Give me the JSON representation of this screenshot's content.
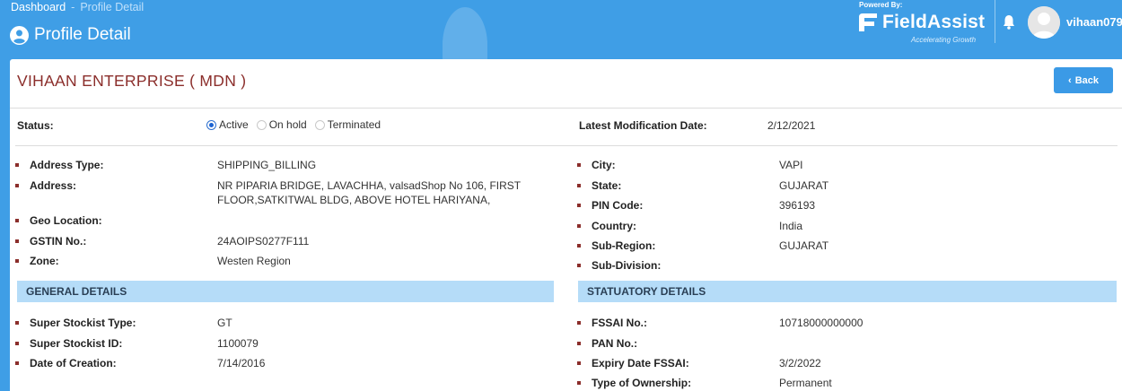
{
  "breadcrumb": {
    "home": "Dashboard",
    "separator": "-",
    "current": "Profile Detail"
  },
  "page_title": "Profile Detail",
  "brand": {
    "powered_by": "Powered By:",
    "name": "FieldAssist",
    "tagline": "Accelerating Growth"
  },
  "user": {
    "name": "vihaan079"
  },
  "company_name": "VIHAAN ENTERPRISE ( MDN )",
  "back_label": "Back",
  "status": {
    "label": "Status:",
    "options": [
      "Active",
      "On hold",
      "Terminated"
    ],
    "selected": "Active"
  },
  "modification": {
    "label": "Latest Modification Date:",
    "value": "2/12/2021"
  },
  "address_left": [
    {
      "label": "Address Type:",
      "value": "SHIPPING_BILLING"
    },
    {
      "label": "Address:",
      "value": "NR PIPARIA BRIDGE, LAVACHHA, valsadShop No 106, FIRST FLOOR,SATKITWAL BLDG, ABOVE HOTEL HARIYANA,"
    },
    {
      "label": "Geo Location:",
      "value": ""
    },
    {
      "label": "GSTIN No.:",
      "value": "24AOIPS0277F111"
    },
    {
      "label": "Zone:",
      "value": "Westen Region"
    }
  ],
  "address_right": [
    {
      "label": "City:",
      "value": "VAPI"
    },
    {
      "label": "State:",
      "value": "GUJARAT"
    },
    {
      "label": "PIN Code:",
      "value": "396193"
    },
    {
      "label": "Country:",
      "value": "India"
    },
    {
      "label": "Sub-Region:",
      "value": "GUJARAT"
    },
    {
      "label": "Sub-Division:",
      "value": ""
    }
  ],
  "general": {
    "heading": "GENERAL DETAILS",
    "rows": [
      {
        "label": "Super Stockist Type:",
        "value": "GT"
      },
      {
        "label": "Super Stockist ID:",
        "value": "1100079"
      },
      {
        "label": "Date of Creation:",
        "value": "7/14/2016"
      }
    ]
  },
  "statutory": {
    "heading": "STATUATORY DETAILS",
    "rows": [
      {
        "label": "FSSAI No.:",
        "value": "10718000000000"
      },
      {
        "label": "PAN No.:",
        "value": ""
      },
      {
        "label": "Expiry Date FSSAI:",
        "value": "3/2/2022"
      },
      {
        "label": "Type of Ownership:",
        "value": "Permanent"
      }
    ]
  },
  "colors": {
    "header_blue": "#3f9ee6",
    "company_red": "#8b2e2b",
    "section_blue": "#b5dcf8",
    "button_blue": "#3b9ae6"
  },
  "icons": {
    "profile": "user-circle-icon",
    "bell": "bell-icon",
    "avatar": "user-avatar-icon",
    "back": "chevron-left-icon",
    "bullet": "square-bullet"
  }
}
